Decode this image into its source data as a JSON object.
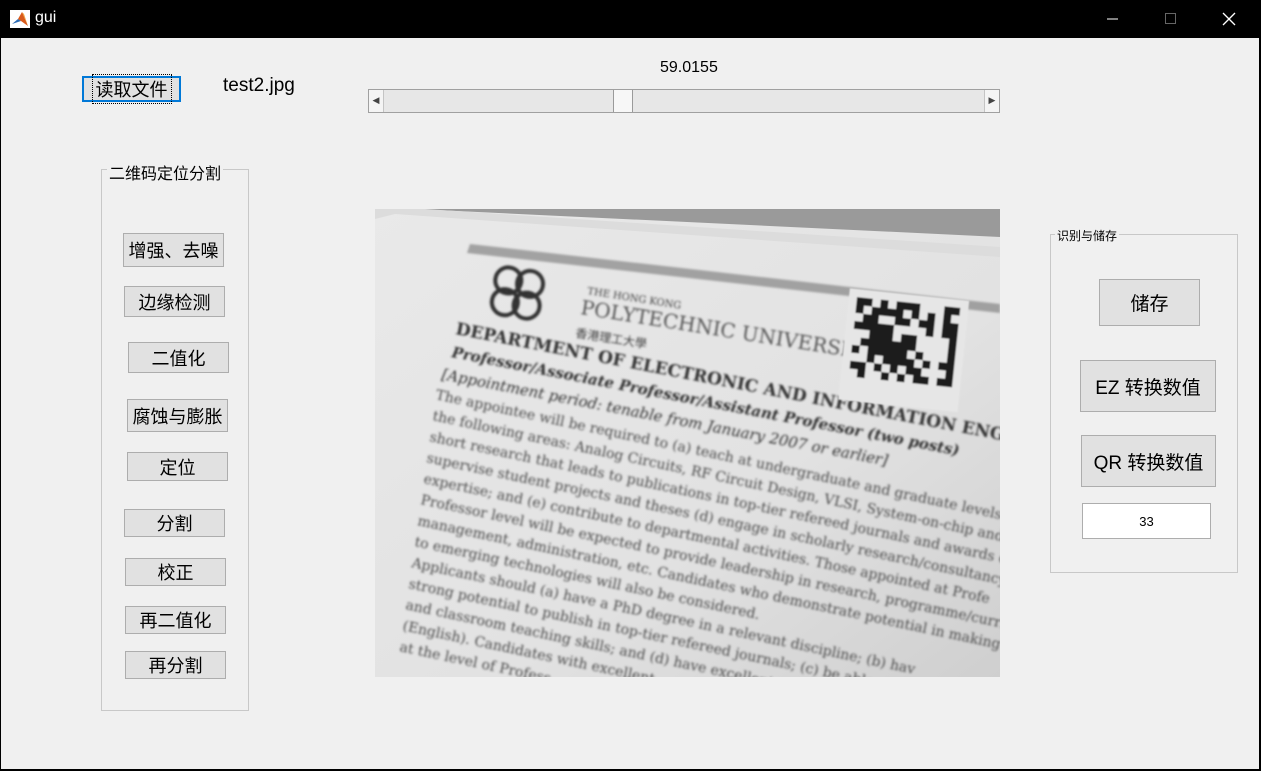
{
  "window": {
    "title": "gui",
    "minimize_icon": "minimize-icon",
    "maximize_icon": "maximize-icon",
    "close_icon": "close-icon"
  },
  "toolbar": {
    "read_file_label": "读取文件",
    "file_name": "test2.jpg"
  },
  "slider": {
    "value_text": "59.0155",
    "value": 59.0155,
    "min": 0,
    "max": 366
  },
  "locate_panel": {
    "title": "二维码定位分割",
    "buttons": {
      "enhance": "增强、去噪",
      "edge": "边缘检测",
      "binarize": "二值化",
      "morph": "腐蚀与膨胀",
      "locate": "定位",
      "segment": "分割",
      "correct": "校正",
      "rebinarize": "再二值化",
      "resegment": "再分割"
    }
  },
  "recognize_panel": {
    "title": "识别与储存",
    "store_label": "储存",
    "ez_label": "EZ 转换数值",
    "qr_label": "QR 转换数值",
    "result_value": "33"
  },
  "image": {
    "description_icon": "photo-icon",
    "logo_line1": "THE HONG KONG",
    "logo_line2": "POLYTECHNIC UNIVERSITY",
    "logo_cn": "香港理工大學",
    "heading": "DEPARTMENT OF ELECTRONIC AND INFORMATION ENGINEERING",
    "subheading": "Professor/Associate Professor/Assistant Professor (two posts)",
    "subheading2": "[Appointment period: tenable from January 2007 or earlier]",
    "body_lines": [
      "The appointee will be required to (a) teach at undergraduate and graduate levels in",
      "the following areas: Analog Circuits, RF Circuit Design, VLSI, System-on-chip and L",
      "short research that leads to publications in top-tier refereed journals and awards of res",
      "supervise student projects and theses (d) engage in scholarly research/consultancy in",
      "expertise; and (e) contribute to departmental activities. Those appointed at Profe",
      "Professor level will be expected to provide leadership in research, programme/curricu",
      "management, administration, etc. Candidates who demonstrate potential in making significant",
      "to emerging technologies will also be considered.",
      "Applicants should (a)  have a PhD degree in a relevant discipline; (b) hav",
      "strong potential to publish in top-tier refereed journals; (c) be able",
      "and classroom teaching skills; and (d) have excellent",
      "(English). Candidates with excellent",
      "at the level of Profess"
    ]
  }
}
